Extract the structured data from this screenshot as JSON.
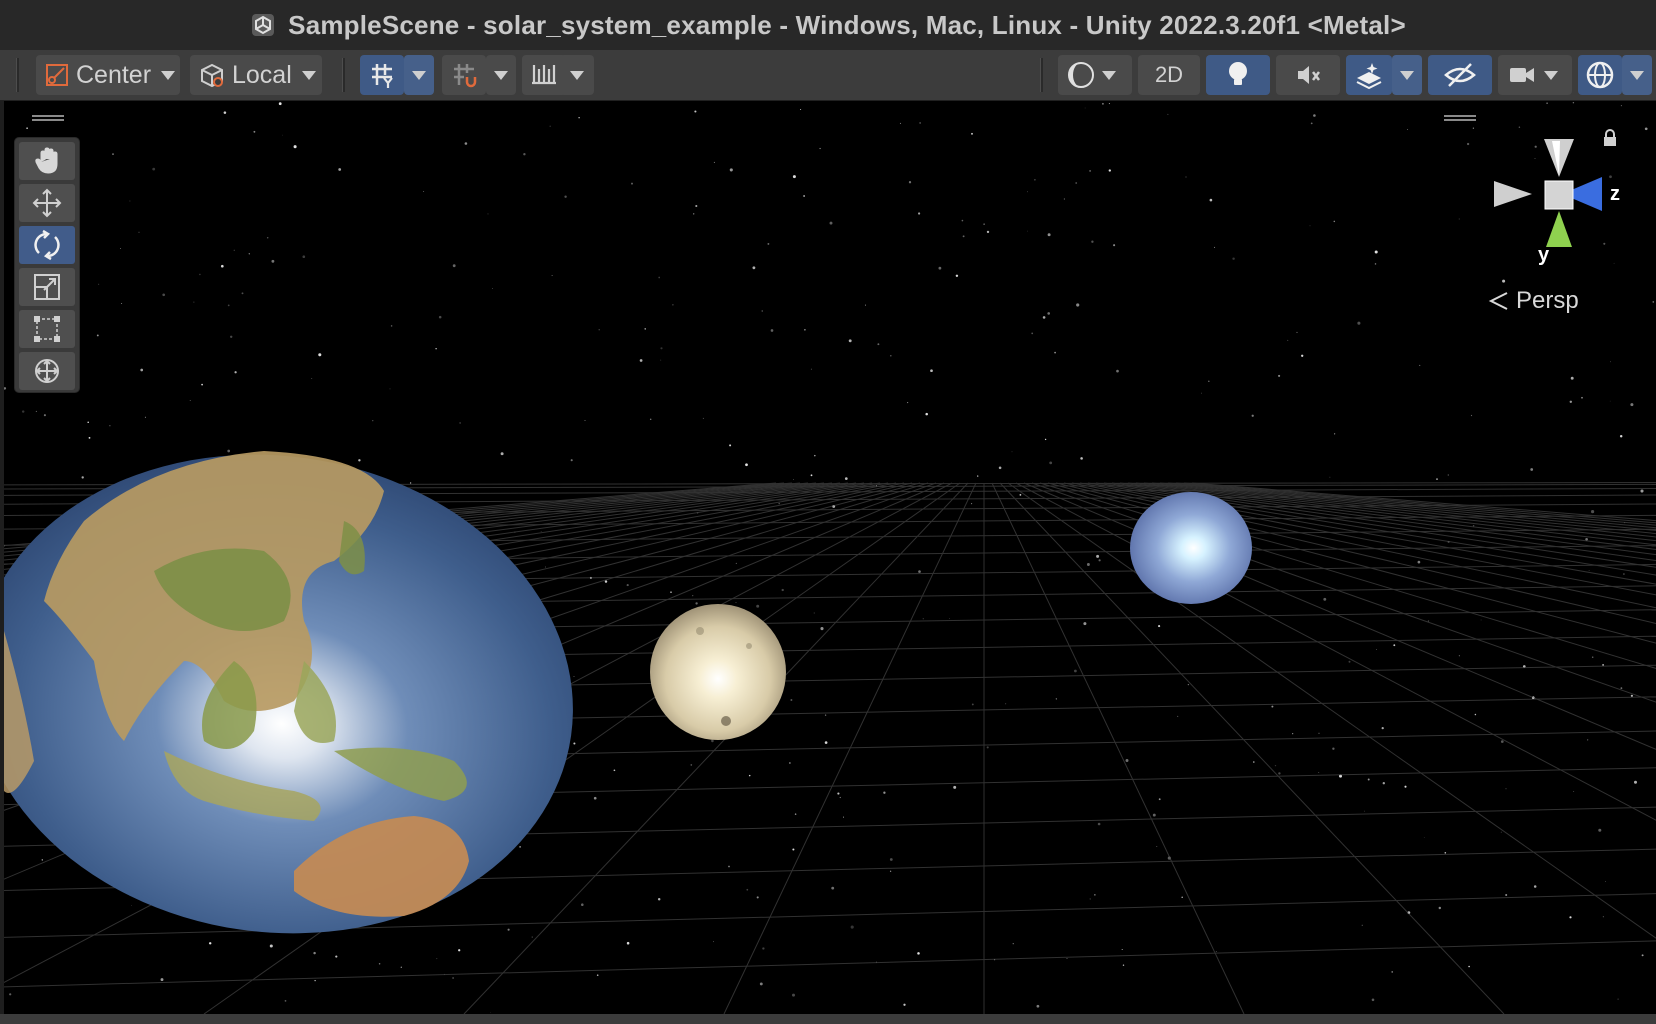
{
  "window": {
    "title": "SampleScene - solar_system_example - Windows, Mac, Linux - Unity 2022.3.20f1 <Metal>"
  },
  "toolbar": {
    "pivot_mode": "Center",
    "pivot_rotation": "Local",
    "toggle_2d": "2D"
  },
  "tools": [
    {
      "name": "hand",
      "active": false
    },
    {
      "name": "move",
      "active": false
    },
    {
      "name": "rotate",
      "active": true
    },
    {
      "name": "scale",
      "active": false
    },
    {
      "name": "rect",
      "active": false
    },
    {
      "name": "transform",
      "active": false
    }
  ],
  "gizmo": {
    "z_label": "z",
    "y_label": "y",
    "projection": "Persp"
  },
  "scene_objects": [
    {
      "name": "earth",
      "color": "#3e5f8f"
    },
    {
      "name": "moon",
      "color": "#e6dcc0"
    },
    {
      "name": "ice-planet",
      "color": "#9fb8e0"
    }
  ],
  "colors": {
    "accent": "#3f5a86",
    "toolbar_bg": "#3c3c3c",
    "title_bg": "#282828"
  }
}
